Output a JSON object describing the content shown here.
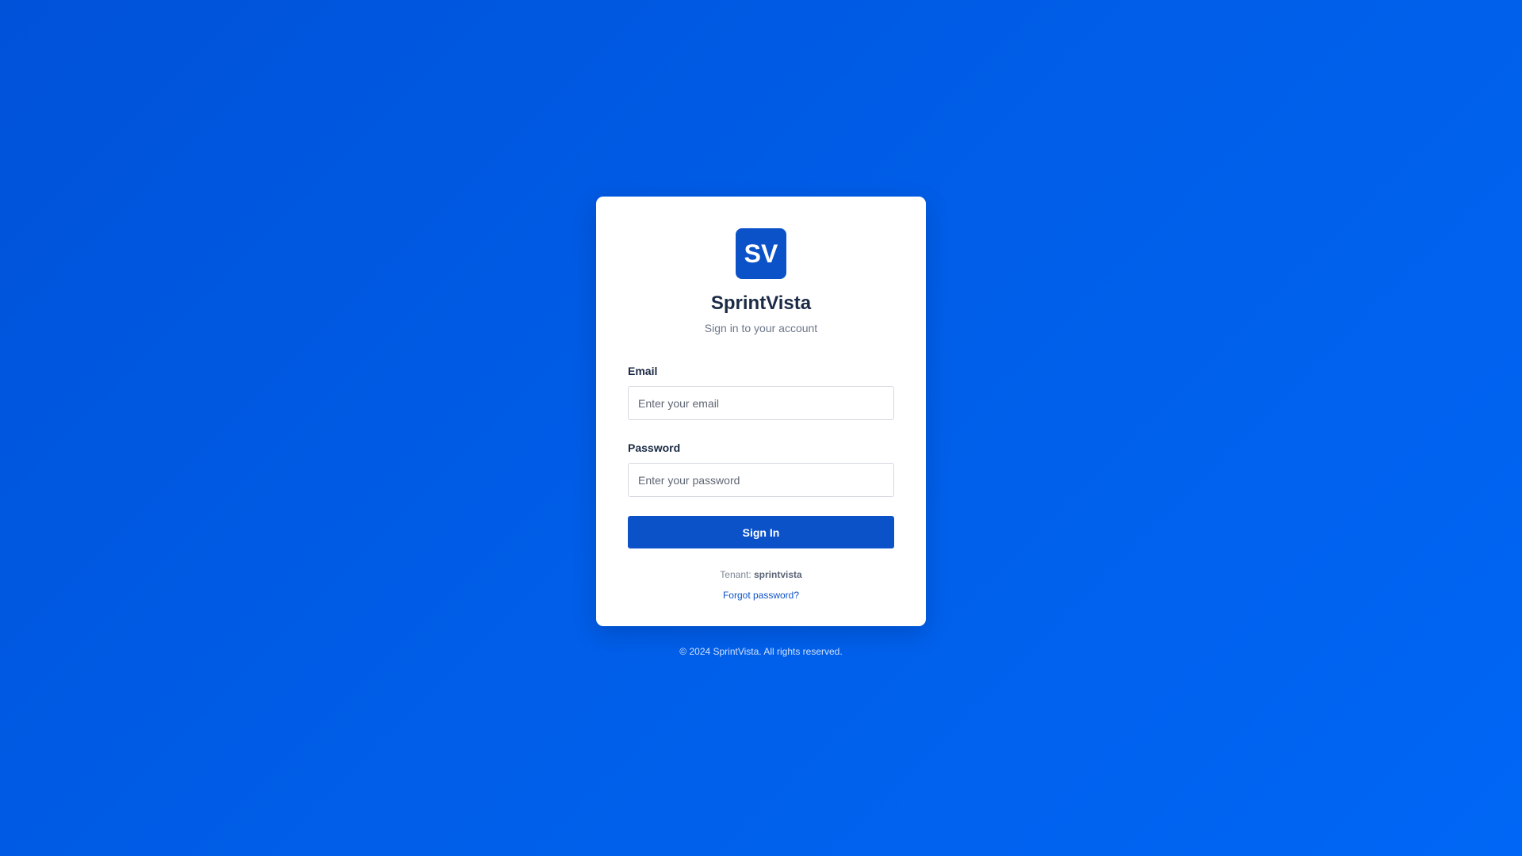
{
  "brand": {
    "logo_text": "SV",
    "app_name": "SprintVista",
    "subtitle": "Sign in to your account"
  },
  "form": {
    "email_label": "Email",
    "email_placeholder": "Enter your email",
    "email_value": "",
    "password_label": "Password",
    "password_placeholder": "Enter your password",
    "password_value": "",
    "submit_label": "Sign In"
  },
  "tenant": {
    "prefix": "Tenant:",
    "name": "sprintvista"
  },
  "forgot_password_label": "Forgot password?",
  "footer_text": "© 2024 SprintVista. All rights reserved.",
  "colors": {
    "background": "#005ee8",
    "primary": "#0b52c9",
    "card": "#ffffff",
    "heading": "#1b2a45"
  }
}
